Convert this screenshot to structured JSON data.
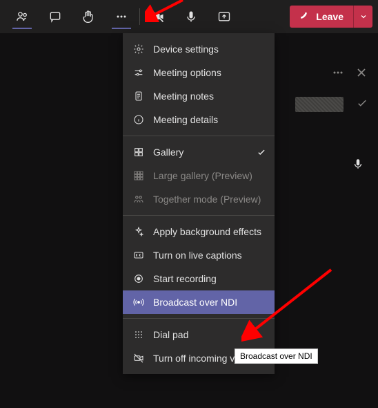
{
  "toolbar": {
    "leave_label": "Leave"
  },
  "menu": {
    "section1": [
      {
        "icon": "gear-icon",
        "label": "Device settings"
      },
      {
        "icon": "sliders-icon",
        "label": "Meeting options"
      },
      {
        "icon": "notes-icon",
        "label": "Meeting notes"
      },
      {
        "icon": "info-icon",
        "label": "Meeting details"
      }
    ],
    "section2": [
      {
        "icon": "grid-icon",
        "label": "Gallery",
        "checked": true
      },
      {
        "icon": "grid-large-icon",
        "label": "Large gallery (Preview)",
        "disabled": true
      },
      {
        "icon": "together-icon",
        "label": "Together mode (Preview)",
        "disabled": true
      }
    ],
    "section3": [
      {
        "icon": "sparkle-icon",
        "label": "Apply background effects"
      },
      {
        "icon": "cc-icon",
        "label": "Turn on live captions"
      },
      {
        "icon": "record-icon",
        "label": "Start recording"
      },
      {
        "icon": "broadcast-icon",
        "label": "Broadcast over NDI",
        "highlight": true
      }
    ],
    "section4": [
      {
        "icon": "dialpad-icon",
        "label": "Dial pad"
      },
      {
        "icon": "video-off-icon",
        "label": "Turn off incoming video"
      }
    ]
  },
  "tooltip": "Broadcast over NDI",
  "colors": {
    "accent": "#6264a7",
    "red": "#c4314b"
  }
}
